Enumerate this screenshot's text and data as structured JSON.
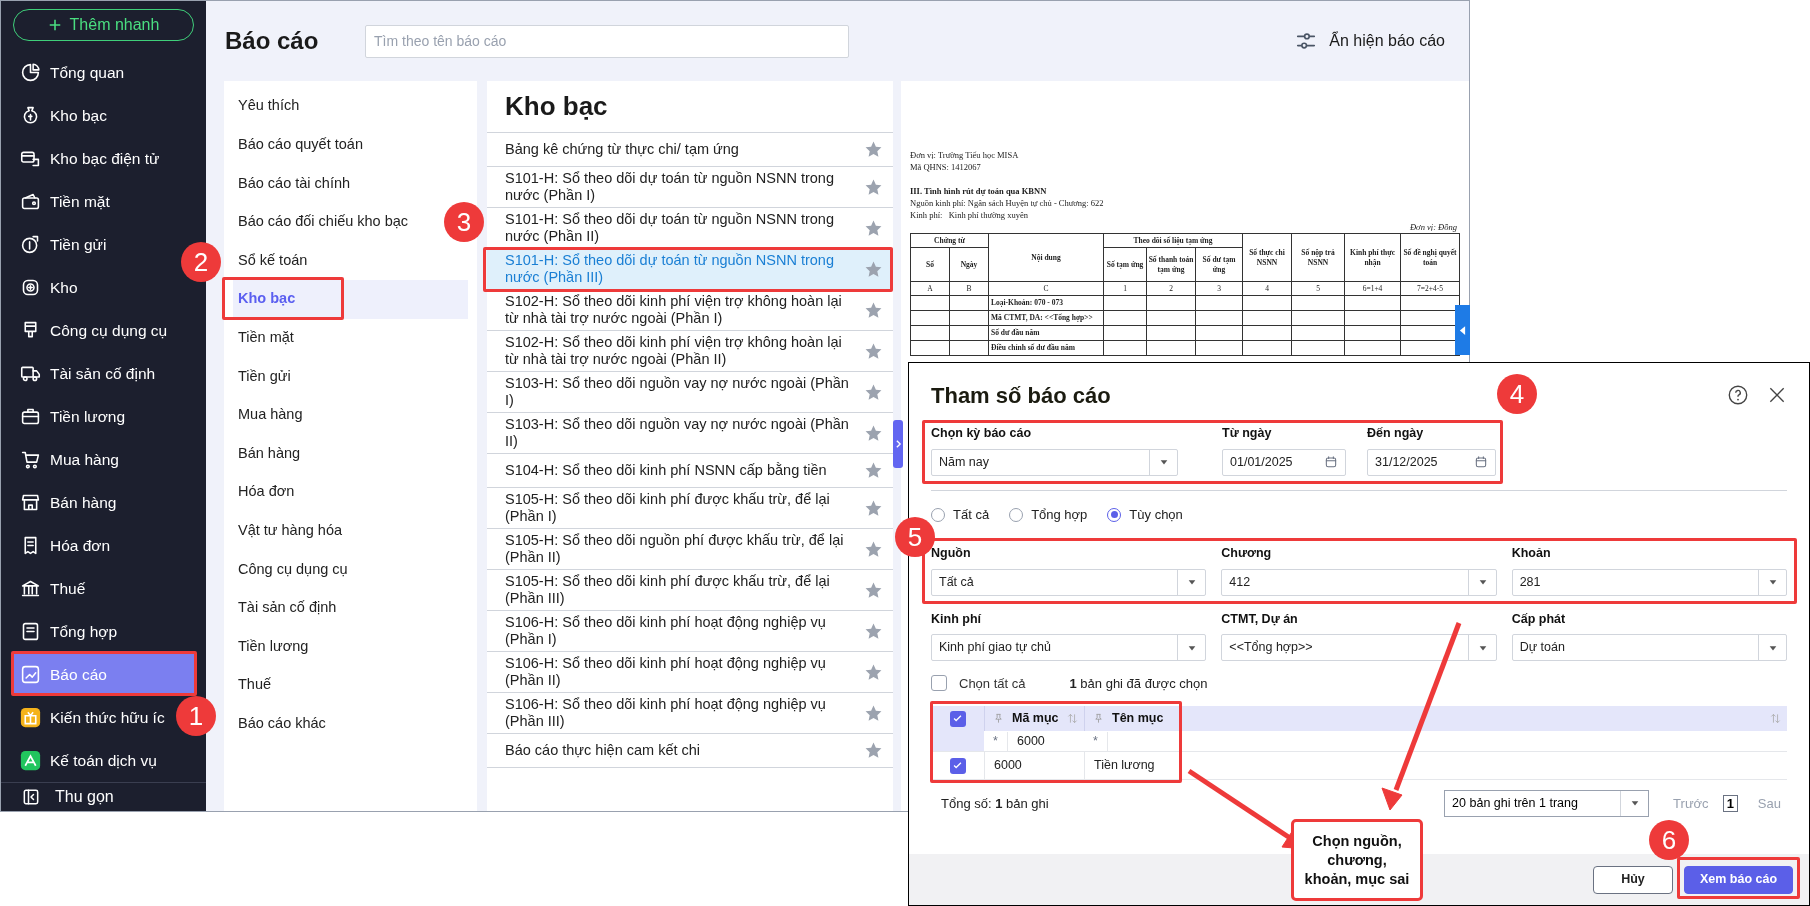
{
  "sidebar": {
    "quick_add": "Thêm nhanh",
    "items": [
      {
        "label": "Tổng quan",
        "selected": false
      },
      {
        "label": "Kho bạc",
        "selected": false
      },
      {
        "label": "Kho bạc điện tử",
        "selected": false
      },
      {
        "label": "Tiền mặt",
        "selected": false
      },
      {
        "label": "Tiền gửi",
        "selected": false
      },
      {
        "label": "Kho",
        "selected": false
      },
      {
        "label": "Công cụ dụng cụ",
        "selected": false
      },
      {
        "label": "Tài sản cố định",
        "selected": false
      },
      {
        "label": "Tiền lương",
        "selected": false
      },
      {
        "label": "Mua hàng",
        "selected": false
      },
      {
        "label": "Bán hàng",
        "selected": false
      },
      {
        "label": "Hóa đơn",
        "selected": false
      },
      {
        "label": "Thuế",
        "selected": false
      },
      {
        "label": "Tổng hợp",
        "selected": false
      },
      {
        "label": "Báo cáo",
        "selected": true
      },
      {
        "label": "Kiến thức hữu íc",
        "selected": false
      },
      {
        "label": "Kế toán dịch vụ",
        "selected": false
      }
    ],
    "collapse": "Thu gọn"
  },
  "header": {
    "title": "Báo cáo",
    "search_placeholder": "Tìm theo tên báo cáo",
    "toggle_label": "Ẩn hiện báo cáo"
  },
  "categories": [
    {
      "label": "Yêu thích",
      "selected": false
    },
    {
      "label": "Báo cáo quyết toán",
      "selected": false
    },
    {
      "label": "Báo cáo tài chính",
      "selected": false
    },
    {
      "label": "Báo cáo đối chiếu kho bạc",
      "selected": false
    },
    {
      "label": "Sổ kế toán",
      "selected": false
    },
    {
      "label": "Kho bạc",
      "selected": true
    },
    {
      "label": "Tiền mặt",
      "selected": false
    },
    {
      "label": "Tiền gửi",
      "selected": false
    },
    {
      "label": "Mua hàng",
      "selected": false
    },
    {
      "label": "Bán hàng",
      "selected": false
    },
    {
      "label": "Hóa đơn",
      "selected": false
    },
    {
      "label": "Vật tư hàng hóa",
      "selected": false
    },
    {
      "label": "Công cụ dụng cụ",
      "selected": false
    },
    {
      "label": "Tài sản cố định",
      "selected": false
    },
    {
      "label": "Tiền lương",
      "selected": false
    },
    {
      "label": "Thuế",
      "selected": false
    },
    {
      "label": "Báo cáo khác",
      "selected": false
    }
  ],
  "report_list": {
    "title": "Kho bạc",
    "items": [
      {
        "label": "Bảng kê chứng từ thực chi/ tạm ứng",
        "selected": false
      },
      {
        "label": "S101-H: Sổ theo dõi dự toán từ nguồn NSNN trong nước (Phần I)",
        "selected": false
      },
      {
        "label": "S101-H: Sổ theo dõi dự toán từ nguồn NSNN trong nước (Phần II)",
        "selected": false
      },
      {
        "label": "S101-H: Sổ theo dõi dự toán từ nguồn NSNN trong nước (Phần III)",
        "selected": true
      },
      {
        "label": "S102-H: Sổ theo dõi kinh phí viện trợ không hoàn lại từ nhà tài trợ nước ngoài (Phần I)",
        "selected": false
      },
      {
        "label": "S102-H: Sổ theo dõi kinh phí viện trợ không hoàn lại từ nhà tài trợ nước ngoài (Phần II)",
        "selected": false
      },
      {
        "label": "S103-H: Sổ theo dõi nguồn vay nợ nước ngoài (Phần I)",
        "selected": false
      },
      {
        "label": "S103-H: Sổ theo dõi nguồn vay nợ nước ngoài (Phần II)",
        "selected": false
      },
      {
        "label": "S104-H: Sổ theo dõi kinh phí NSNN cấp bằng tiền",
        "selected": false
      },
      {
        "label": "S105-H: Sổ theo dõi kinh phí được khấu trừ, để lại (Phần I)",
        "selected": false
      },
      {
        "label": "S105-H: Sổ theo dõi nguồn phí được khấu trừ, để lại (Phần II)",
        "selected": false
      },
      {
        "label": "S105-H: Sổ theo dõi kinh phí được khấu trừ, để lại (Phần III)",
        "selected": false
      },
      {
        "label": "S106-H: Sổ theo dõi kinh phí hoạt động nghiệp vụ (Phần I)",
        "selected": false
      },
      {
        "label": "S106-H: Sổ theo dõi kinh phí hoạt động nghiệp vụ (Phần II)",
        "selected": false
      },
      {
        "label": "S106-H: Sổ theo dõi kinh phí hoạt động nghiệp vụ (Phần III)",
        "selected": false
      },
      {
        "label": "Báo cáo thực hiện cam kết chi",
        "selected": false
      }
    ]
  },
  "preview": {
    "unit_lines": [
      "Đơn vị: Trường Tiểu học MISA",
      "Mã QHNS: 1412067"
    ],
    "section_title": "III. Tình hình rút dự toán qua KBNN",
    "info_lines": [
      "Nguồn kinh phí: Ngân sách Huyện tự chủ - Chương: 622",
      "Kinh phí:   Kinh phí thường xuyên"
    ],
    "currency_note": "Đơn vị: Đồng",
    "columns": [
      {
        "label": "Chứng từ",
        "children": [
          {
            "label": "Số"
          },
          {
            "label": "Ngày"
          }
        ]
      },
      {
        "label": "Nội dung"
      },
      {
        "label": "Theo dõi số liệu tạm ứng",
        "children": [
          {
            "label": "Số tạm ứng"
          },
          {
            "label": "Số thanh toán tạm ứng"
          },
          {
            "label": "Số dư tạm ứng"
          }
        ]
      },
      {
        "label": "Số thực chi NSNN"
      },
      {
        "label": "Số nộp trả NSNN"
      },
      {
        "label": "Kinh phí thực nhận"
      },
      {
        "label": "Số đề nghị quyết toán"
      }
    ],
    "code_row": [
      "A",
      "B",
      "C",
      "1",
      "2",
      "3",
      "4",
      "5",
      "6=1+4",
      "7=2+4-5"
    ],
    "rows": [
      "Loại-Khoản: 070 - 073",
      "Mã CTMT, DA: <<Tổng hợp>>",
      "Số dư đầu năm",
      "Điều chỉnh số dư đầu năm"
    ]
  },
  "dialog": {
    "title": "Tham số báo cáo",
    "period": {
      "label": "Chọn kỳ báo cáo",
      "value": "Năm nay"
    },
    "from": {
      "label": "Từ ngày",
      "value": "01/01/2025"
    },
    "to": {
      "label": "Đến ngày",
      "value": "31/12/2025"
    },
    "scope_options": [
      {
        "label": "Tất cả",
        "selected": false
      },
      {
        "label": "Tổng hợp",
        "selected": false
      },
      {
        "label": "Tùy chọn",
        "selected": true
      }
    ],
    "filters": [
      {
        "label": "Nguồn",
        "value": "Tất cả"
      },
      {
        "label": "Chương",
        "value": "412"
      },
      {
        "label": "Khoản",
        "value": "281"
      },
      {
        "label": "Kinh phí",
        "value": "Kinh phí giao tự chủ"
      },
      {
        "label": "CTMT, Dự án",
        "value": "<<Tổng hợp>>"
      },
      {
        "label": "Cấp phát",
        "value": "Dự toán"
      }
    ],
    "select_all": {
      "label": "Chọn tất cả",
      "checked": false
    },
    "selected_count": "**1** bản ghi đã được chọn",
    "grid": {
      "header_checked": true,
      "columns": [
        "Mã mục",
        "Tên mục"
      ],
      "filter_row": [
        {
          "operator": "*",
          "value": "6000"
        },
        {
          "operator": "*"
        }
      ],
      "rows": [
        {
          "checked": true,
          "cells": [
            "6000",
            "Tiền lương"
          ]
        }
      ]
    },
    "total": "Tổng số: **1** bản ghi",
    "page_size": "20 bản ghi trên 1 trang",
    "prev": {
      "label": "Trước",
      "disabled": true
    },
    "page": "1",
    "next": {
      "label": "Sau",
      "disabled": true
    },
    "buttons": [
      {
        "label": "Hủy",
        "kind": "secondary"
      },
      {
        "label": "Xem báo cáo",
        "kind": "primary"
      }
    ]
  },
  "annotations": {
    "markers": [
      "1",
      "2",
      "3",
      "4",
      "5",
      "6"
    ],
    "callout": "Chọn nguồn,\nchương,\nkhoản, mục sai"
  }
}
